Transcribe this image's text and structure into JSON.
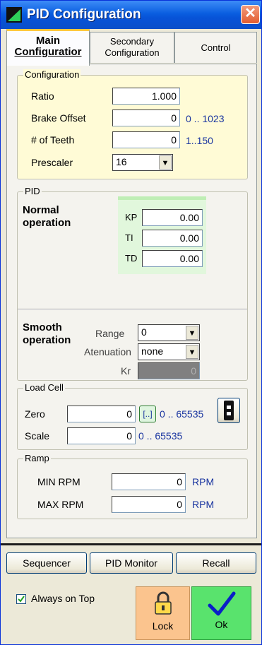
{
  "window": {
    "title": "PID Configuration",
    "close_glyph": "✕"
  },
  "tabs": [
    {
      "line1": "Main",
      "line2": "Configuratior",
      "active": true
    },
    {
      "line1": "Secondary",
      "line2": "Configuration",
      "active": false
    },
    {
      "line1": "Control",
      "line2": "",
      "active": false
    }
  ],
  "configuration": {
    "group_label": "Configuration",
    "ratio_label": "Ratio",
    "ratio_value": "1.000",
    "brake_offset_label": "Brake Offset",
    "brake_offset_value": "0",
    "brake_offset_range": "0 .. 1023",
    "teeth_label": "# of Teeth",
    "teeth_value": "0",
    "teeth_range": "1..150",
    "prescaler_label": "Prescaler",
    "prescaler_value": "16"
  },
  "pid": {
    "group_label": "PID",
    "normal_label": "Normal operation",
    "kp_label": "KP",
    "kp_value": "0.00",
    "ti_label": "TI",
    "ti_value": "0.00",
    "td_label": "TD",
    "td_value": "0.00",
    "smooth_label": "Smooth operation",
    "range_label": "Range",
    "range_value": "0",
    "atenuation_label": "Atenuation",
    "atenuation_value": "none",
    "kr_label": "Kr",
    "kr_value": "0"
  },
  "load_cell": {
    "group_label": "Load Cell",
    "zero_label": "Zero",
    "zero_value": "0",
    "zero_button": "[..]",
    "zero_range": "0 .. 65535",
    "scale_label": "Scale",
    "scale_value": "0",
    "scale_range": "0 .. 65535"
  },
  "ramp": {
    "group_label": "Ramp",
    "min_label": "MIN RPM",
    "min_value": "0",
    "min_unit": "RPM",
    "max_label": "MAX RPM",
    "max_value": "0",
    "max_unit": "RPM"
  },
  "bottom": {
    "sequencer": "Sequencer",
    "pid_monitor": "PID Monitor",
    "recall": "Recall",
    "always_on_top": "Always on Top",
    "always_on_top_checked": true,
    "lock": "Lock",
    "ok": "Ok"
  },
  "colors": {
    "config_bg": "#fffbd6",
    "pid_bg": "#e1f7dc",
    "lock_bg": "#fbc48e",
    "ok_bg": "#59e36d"
  }
}
